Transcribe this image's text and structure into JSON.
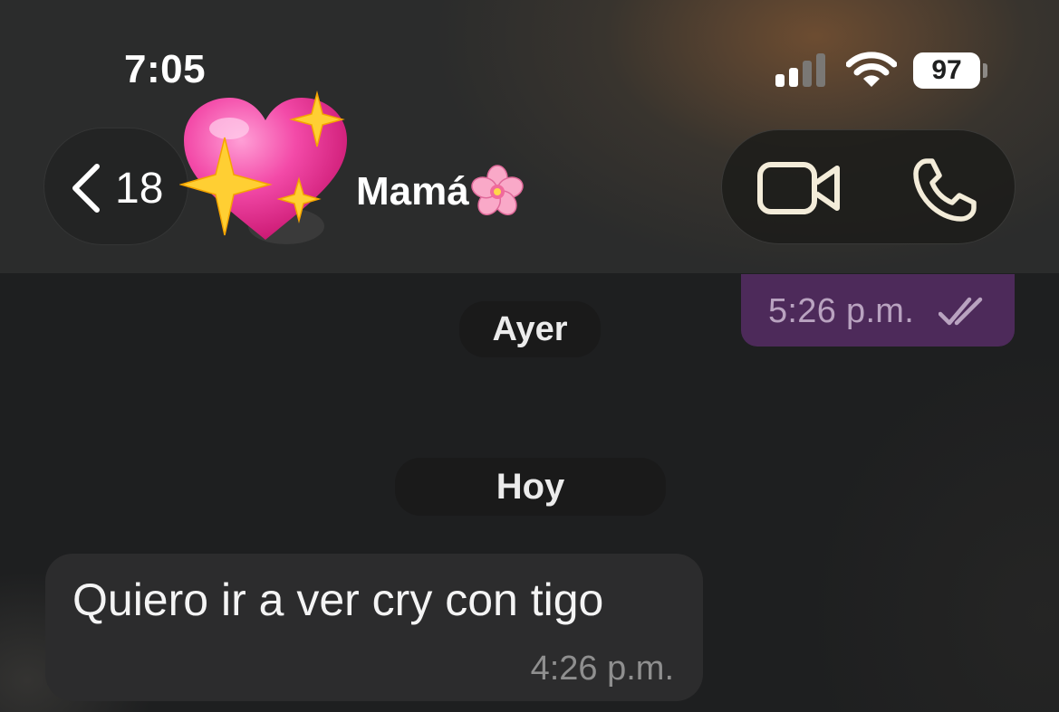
{
  "status_bar": {
    "time": "7:05",
    "battery": "97",
    "signal_icon": "signal-bars-icon",
    "wifi_icon": "wifi-icon"
  },
  "header": {
    "back_count": "18",
    "contact_name": "Mamá",
    "name_emoji_icon": "cherry-blossom-icon",
    "avatar_icon": "sparkling-heart-icon",
    "video_call_icon": "video-camera-icon",
    "voice_call_icon": "phone-icon"
  },
  "messages": {
    "sent_partial": {
      "time": "5:26 p.m.",
      "status_icon": "double-check-icon"
    },
    "date_yesterday": "Ayer",
    "date_today": "Hoy",
    "received": {
      "text": "Quiero ir a ver cry con tigo",
      "time": "4:26 p.m."
    }
  },
  "colors": {
    "sent_bubble": "#4d2a5a",
    "received_bubble": "#2c2c2d",
    "header_bg": "#2b2c2c",
    "chat_bg": "#1e1f20"
  }
}
